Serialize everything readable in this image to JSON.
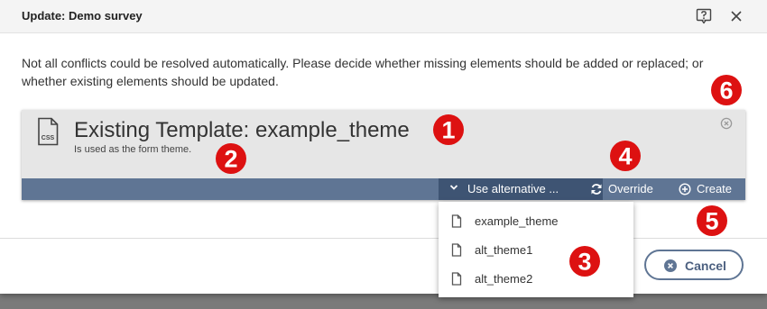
{
  "dialog": {
    "title": "Update: Demo survey",
    "message": "Not all conflicts could be resolved automatically. Please decide whether missing elements should be added or replaced; or whether existing elements should be updated."
  },
  "template": {
    "title": "Existing Template: example_theme",
    "subtitle": "Is used as the form theme.",
    "icon_text": "CSS"
  },
  "actions": {
    "alternative_label": "Use alternative ...",
    "override_label": "Override",
    "create_label": "Create"
  },
  "dropdown": {
    "items": [
      {
        "label": "example_theme"
      },
      {
        "label": "alt_theme1"
      },
      {
        "label": "alt_theme2"
      }
    ]
  },
  "footer": {
    "cancel_label": "Cancel"
  },
  "markers": [
    "1",
    "2",
    "3",
    "4",
    "5",
    "6"
  ],
  "colors": {
    "accent": "#5f7594",
    "accent_dark": "#3e5473",
    "marker": "#dd1111"
  }
}
